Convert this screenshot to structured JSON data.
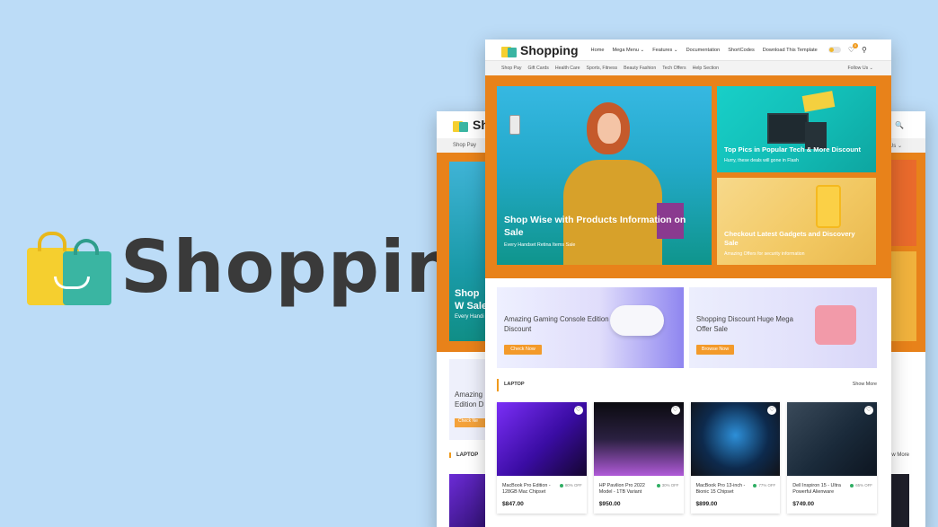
{
  "brand": {
    "name": "Shopping"
  },
  "nav": {
    "menu": [
      "Home",
      "Mega Menu ⌄",
      "Features ⌄",
      "Documentation",
      "ShortCodes",
      "Download This Template"
    ],
    "heart_count": "0",
    "sub_links": [
      "Shop Pay",
      "Gift Cards",
      "Health Care",
      "Sports, Fitness",
      "Beauty Fashion",
      "Tech Offers",
      "Help Section"
    ],
    "follow_label": "Follow Us ⌄"
  },
  "hero": {
    "main_title": "Shop Wise with Products Information on Sale",
    "main_sub": "Every Handset Retina Items Sale",
    "card1_title": "Top Pics in Popular Tech & More Discount",
    "card1_sub": "Hurry, these deals will gone in Flash",
    "card2_title": "Checkout Latest Gadgets and Discovery Sale",
    "card2_sub": "Amazing Offers for security information"
  },
  "promos": [
    {
      "title": "Amazing Gaming Console Edition Discount",
      "button": "Check Now"
    },
    {
      "title": "Shopping Discount Huge Mega Offer Sale",
      "button": "Browse Now"
    }
  ],
  "section": {
    "title": "LAPTOP",
    "show_more": "Show More"
  },
  "products": [
    {
      "name": "MacBook Pro Edition - 128GB Mac Chipset",
      "price": "$847.00",
      "off": "80% OFF"
    },
    {
      "name": "HP Pavilion Pro 2022 Model - 1TB Variant",
      "price": "$950.00",
      "off": "30% OFF"
    },
    {
      "name": "MacBook Pro 13-inch - Bionic 15 Chipset",
      "price": "$899.00",
      "off": "77% OFF"
    },
    {
      "name": "Dell Inspiron 15 - Ultra Powerful Alienware",
      "price": "$749.00",
      "off": "65% OFF"
    }
  ],
  "back_window": {
    "logo_fragment": "Sh",
    "sub_fragment": "Shop Pay",
    "follow_fragment": "Us ⌄",
    "hero_title": "Shop W Sale",
    "hero_sub": "Every Handi",
    "promo_title": "Amazing Edition D",
    "promo_btn": "Check Ne",
    "section_title": "LAPTOP",
    "show_more": "ow More"
  },
  "colors": {
    "background": "#bcdcf7",
    "accent_orange": "#e8821a",
    "button_orange": "#f39a2a",
    "bag_yellow": "#f5cf2f",
    "bag_teal": "#3ab5a2"
  }
}
